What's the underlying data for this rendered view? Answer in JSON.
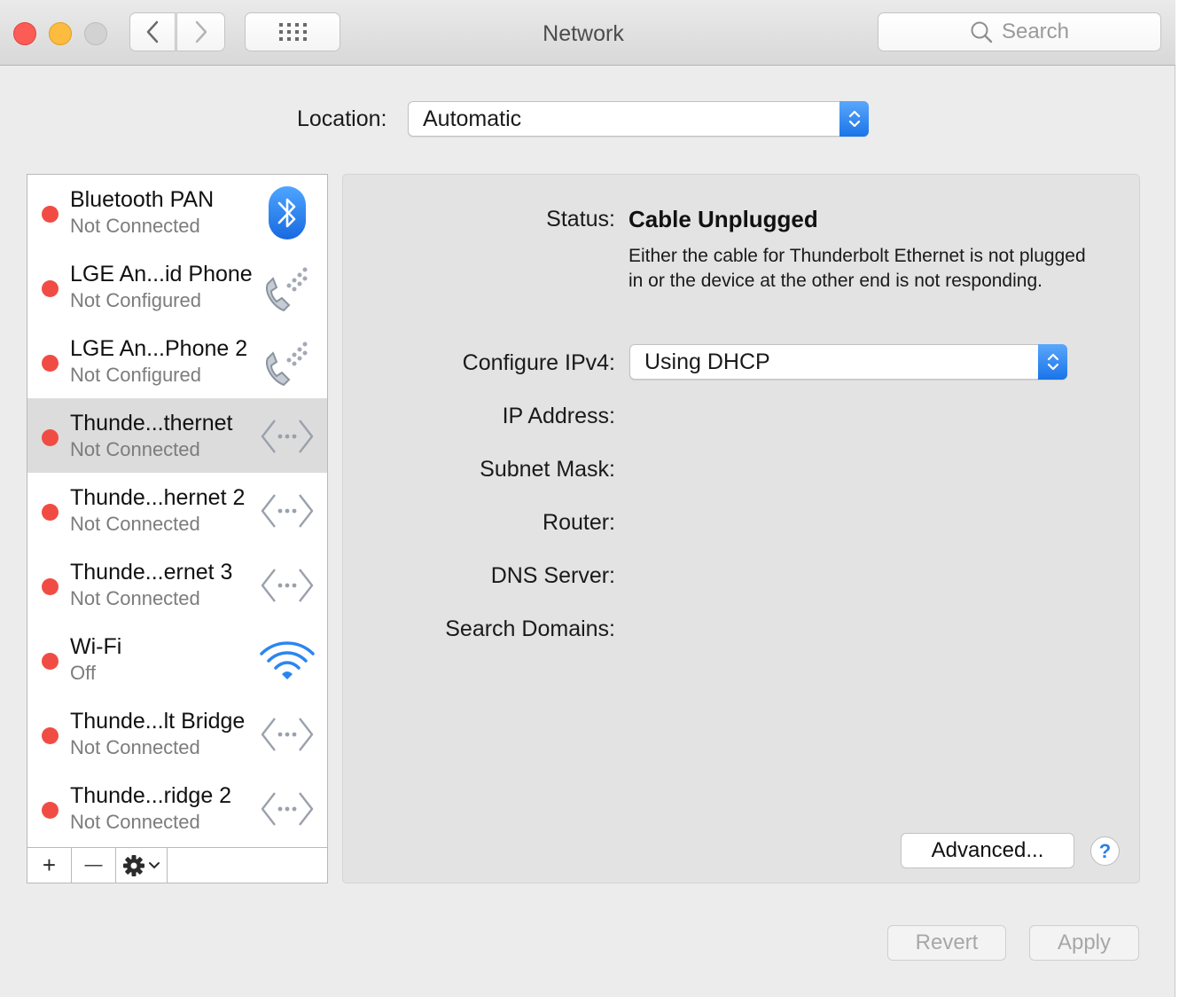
{
  "window": {
    "title": "Network",
    "search_placeholder": "Search"
  },
  "location": {
    "label": "Location:",
    "value": "Automatic"
  },
  "services": [
    {
      "name": "Bluetooth PAN",
      "status": "Not Connected",
      "icon": "bluetooth-icon",
      "selected": false
    },
    {
      "name": "LGE An...id Phone",
      "status": "Not Configured",
      "icon": "phone-modem-icon",
      "selected": false
    },
    {
      "name": "LGE An...Phone 2",
      "status": "Not Configured",
      "icon": "phone-modem-icon",
      "selected": false
    },
    {
      "name": "Thunde...thernet",
      "status": "Not Connected",
      "icon": "ethernet-icon",
      "selected": true
    },
    {
      "name": "Thunde...hernet 2",
      "status": "Not Connected",
      "icon": "ethernet-icon",
      "selected": false
    },
    {
      "name": "Thunde...ernet 3",
      "status": "Not Connected",
      "icon": "ethernet-icon",
      "selected": false
    },
    {
      "name": "Wi-Fi",
      "status": "Off",
      "icon": "wifi-icon",
      "selected": false
    },
    {
      "name": "Thunde...lt Bridge",
      "status": "Not Connected",
      "icon": "ethernet-icon",
      "selected": false
    },
    {
      "name": "Thunde...ridge 2",
      "status": "Not Connected",
      "icon": "ethernet-icon",
      "selected": false
    }
  ],
  "sidebar_toolbar": {
    "add": "+",
    "remove": "—"
  },
  "detail": {
    "status_label": "Status:",
    "status_value": "Cable Unplugged",
    "status_description": "Either the cable for Thunderbolt Ethernet is not plugged in or the device at the other end is not responding.",
    "configure_label": "Configure IPv4:",
    "configure_value": "Using DHCP",
    "ip_label": "IP Address:",
    "subnet_label": "Subnet Mask:",
    "router_label": "Router:",
    "dns_label": "DNS Server:",
    "search_domains_label": "Search Domains:",
    "advanced_button": "Advanced...",
    "help_button": "?"
  },
  "footer": {
    "revert_button": "Revert",
    "apply_button": "Apply"
  },
  "colors": {
    "status_red": "#f14c44",
    "accent_blue": "#1a74e8",
    "selected_row": "#dcdcdc"
  }
}
